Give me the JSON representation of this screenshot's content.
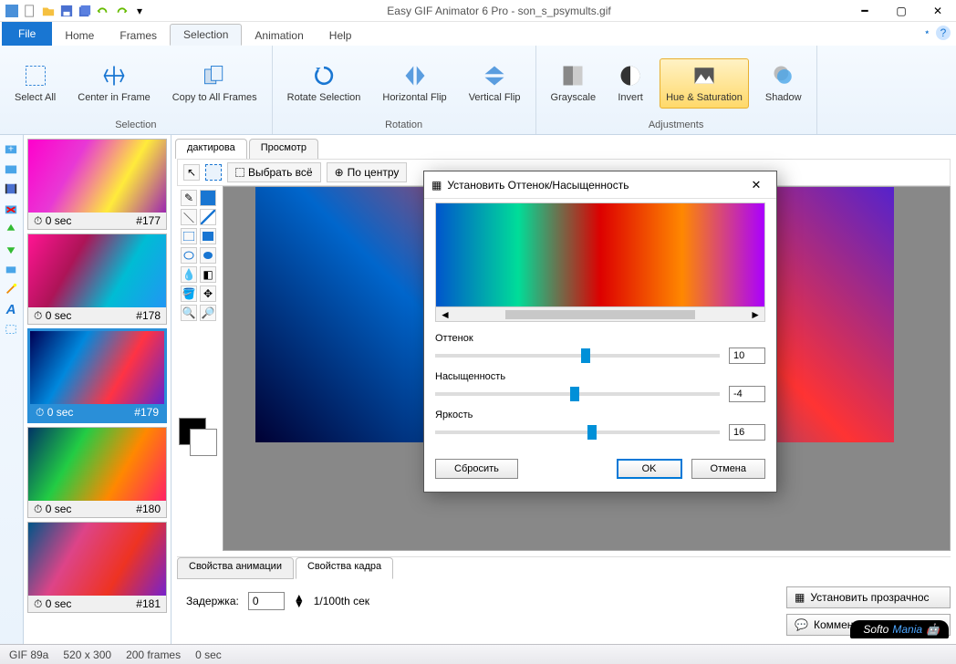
{
  "titlebar": {
    "app_title": "Easy GIF Animator 6 Pro - son_s_psymults.gif"
  },
  "tabs": {
    "file": "File",
    "home": "Home",
    "frames": "Frames",
    "selection": "Selection",
    "animation": "Animation",
    "help": "Help"
  },
  "ribbon": {
    "select_all": "Select\nAll",
    "center_frame": "Center\nin Frame",
    "copy_all": "Copy to\nAll Frames",
    "group_selection": "Selection",
    "rotate_sel": "Rotate\nSelection",
    "hflip": "Horizontal\nFlip",
    "vflip": "Vertical\nFlip",
    "group_rotation": "Rotation",
    "grayscale": "Grayscale",
    "invert": "Invert",
    "hue_sat": "Hue &\nSaturation",
    "shadow": "Shadow",
    "group_adjustments": "Adjustments"
  },
  "frames": [
    {
      "delay": "0 sec",
      "num": "#177"
    },
    {
      "delay": "0 sec",
      "num": "#178"
    },
    {
      "delay": "0 sec",
      "num": "#179"
    },
    {
      "delay": "0 sec",
      "num": "#180"
    },
    {
      "delay": "0 sec",
      "num": "#181"
    }
  ],
  "editor": {
    "tab1": "дактирова",
    "tab2": "Просмотр",
    "select_all_btn": "Выбрать всё",
    "center_btn": "По центру"
  },
  "props": {
    "tab_anim": "Свойства анимации",
    "tab_frame": "Свойства кадра",
    "delay_label": "Задержка:",
    "delay_value": "0",
    "delay_unit": "1/100th сек",
    "btn_transparency": "Установить прозрачнос",
    "btn_comment": "Комментарий изображ"
  },
  "status": {
    "gif": "GIF 89a",
    "dim": "520 x 300",
    "frames": "200 frames",
    "time": "0 sec"
  },
  "dialog": {
    "title": "Установить Оттенок/Насыщенность",
    "hue_label": "Оттенок",
    "hue_value": "10",
    "sat_label": "Насыщенность",
    "sat_value": "-4",
    "bright_label": "Яркость",
    "bright_value": "16",
    "reset": "Сбросить",
    "ok": "OK",
    "cancel": "Отмена"
  },
  "watermark": {
    "soft": "Softo",
    "mania": "Mania"
  }
}
